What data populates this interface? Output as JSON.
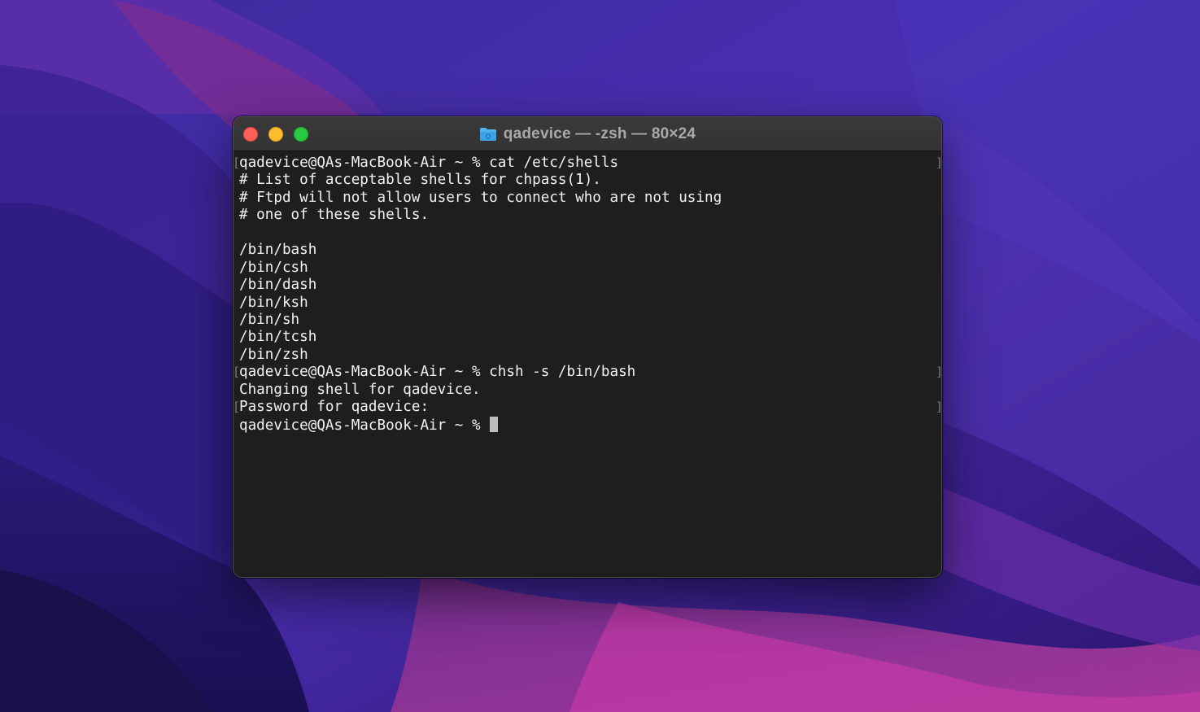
{
  "window": {
    "title": "qadevice — -zsh — 80×24"
  },
  "terminal": {
    "lines": [
      {
        "text": "qadevice@QAs-MacBook-Air ~ % cat /etc/shells",
        "mark": true
      },
      {
        "text": "# List of acceptable shells for chpass(1).",
        "mark": false
      },
      {
        "text": "# Ftpd will not allow users to connect who are not using",
        "mark": false
      },
      {
        "text": "# one of these shells.",
        "mark": false
      },
      {
        "text": "",
        "mark": false
      },
      {
        "text": "/bin/bash",
        "mark": false
      },
      {
        "text": "/bin/csh",
        "mark": false
      },
      {
        "text": "/bin/dash",
        "mark": false
      },
      {
        "text": "/bin/ksh",
        "mark": false
      },
      {
        "text": "/bin/sh",
        "mark": false
      },
      {
        "text": "/bin/tcsh",
        "mark": false
      },
      {
        "text": "/bin/zsh",
        "mark": false
      },
      {
        "text": "qadevice@QAs-MacBook-Air ~ % chsh -s /bin/bash",
        "mark": true
      },
      {
        "text": "Changing shell for qadevice.",
        "mark": false
      },
      {
        "text": "Password for qadevice:",
        "mark": true
      },
      {
        "text": "qadevice@QAs-MacBook-Air ~ % ",
        "mark": false,
        "cursor": true
      }
    ]
  },
  "icons": {
    "title_icon": "folder-icon",
    "traffic_lights": [
      "close-button",
      "minimize-button",
      "zoom-button"
    ]
  },
  "colors": {
    "close": "#fe5f57",
    "minimize": "#febc2e",
    "zoom": "#28c840",
    "terminal_bg": "#1e1e1e",
    "terminal_text": "#f2f2f2"
  }
}
